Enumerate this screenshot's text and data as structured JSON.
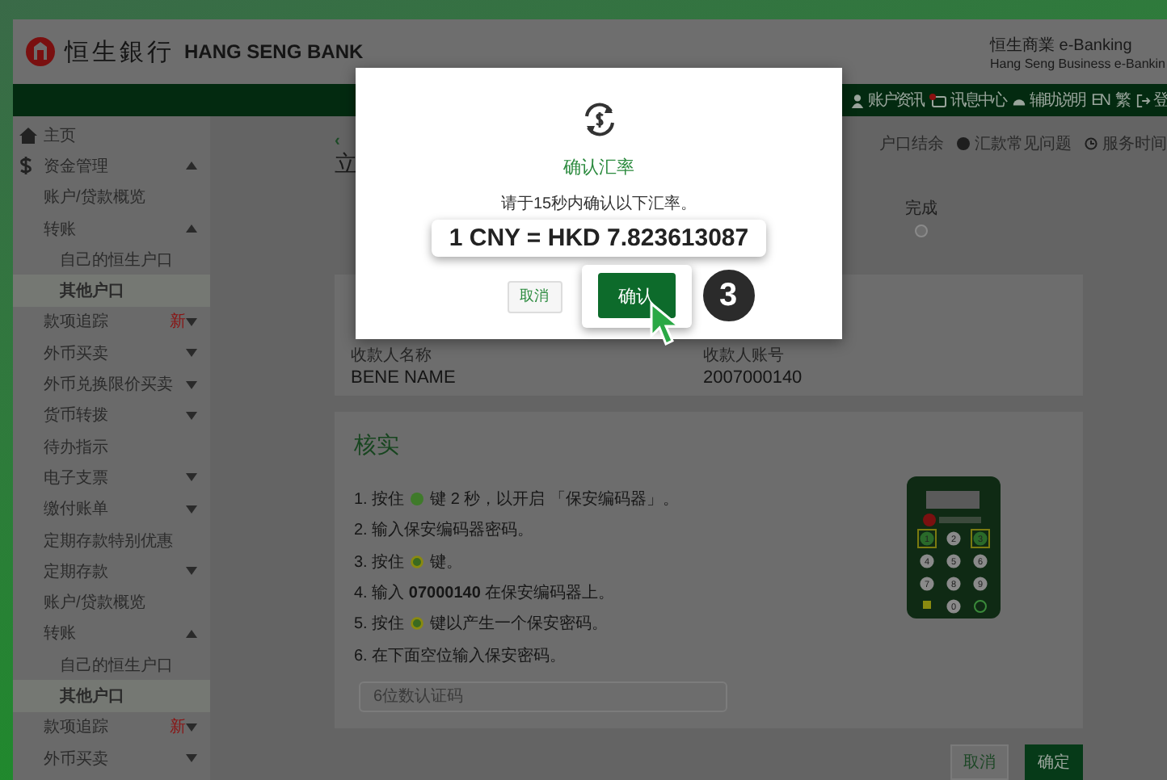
{
  "header": {
    "brand_cn": "恒生銀行",
    "brand_en": "HANG SENG BANK",
    "product_cn": "恒生商業 e-Banking",
    "product_en": "Hang Seng Business e-Bankin"
  },
  "nav": [
    {
      "label": "账户资讯"
    },
    {
      "label": "讯息中心",
      "alert": true
    },
    {
      "label": "辅助说明"
    },
    {
      "label": "EN"
    },
    {
      "label": "繁"
    },
    {
      "label": "登"
    }
  ],
  "sidebar": [
    {
      "label": "主页",
      "selected": false
    },
    {
      "label": "资金管理",
      "expanded": true,
      "selected": false
    },
    {
      "label": "账户/贷款概览",
      "selected": false
    },
    {
      "label": "转账",
      "expanded": true,
      "selected": false,
      "children": [
        {
          "label": "自己的恒生户口",
          "selected": false
        },
        {
          "label": "其他户口",
          "selected": true
        }
      ]
    },
    {
      "label": "款项追踪",
      "badge": "新",
      "expanded": false,
      "selected": false
    },
    {
      "label": "外币买卖",
      "expanded": false,
      "selected": false
    },
    {
      "label": "外币兑换限价买卖",
      "expanded": false,
      "selected": false
    },
    {
      "label": "货币转拨",
      "expanded": false,
      "selected": false
    },
    {
      "label": "待办指示",
      "selected": false
    },
    {
      "label": "电子支票",
      "expanded": false,
      "selected": false
    },
    {
      "label": "缴付账单",
      "expanded": false,
      "selected": false
    },
    {
      "label": "定期存款特别优惠",
      "selected": false
    },
    {
      "label": "定期存款",
      "expanded": false,
      "selected": false
    },
    {
      "label": "账户/贷款概览",
      "selected": false
    },
    {
      "label": "转账",
      "expanded": true,
      "selected": false,
      "children": [
        {
          "label": "自己的恒生户口",
          "selected": false
        },
        {
          "label": "其他户口",
          "selected": true
        }
      ]
    },
    {
      "label": "款项追踪",
      "badge": "新",
      "expanded": false,
      "selected": false
    },
    {
      "label": "外币买卖",
      "expanded": false,
      "selected": false
    }
  ],
  "page": {
    "back": "‹",
    "title": "立",
    "links": [
      {
        "label": "户口结余"
      },
      {
        "label": "汇款常见问题"
      },
      {
        "label": "服务时间"
      }
    ],
    "stepper": {
      "label": "完成",
      "done": false
    },
    "payee": [
      {
        "label": "收款人名称",
        "value": "BENE NAME"
      },
      {
        "label": "收款人账号",
        "value": "2007000140"
      }
    ],
    "verify": {
      "title": "核实",
      "steps": [
        {
          "parts": [
            {
              "kind": "text",
              "text": "1. 按住"
            },
            {
              "kind": "key"
            },
            {
              "kind": "text",
              "text": "键 2 秒，以开启 「保安编码器」。"
            }
          ]
        },
        {
          "parts": [
            {
              "kind": "text",
              "text": "2. 输入保安编码器密码。"
            }
          ]
        },
        {
          "parts": [
            {
              "kind": "text",
              "text": "3. 按住"
            },
            {
              "kind": "ringkey"
            },
            {
              "kind": "text",
              "text": "键。"
            }
          ]
        },
        {
          "parts": [
            {
              "kind": "text",
              "text": "4. 输入 **07000140** 在保安编码器上。"
            }
          ]
        },
        {
          "parts": [
            {
              "kind": "text",
              "text": "5. 按住"
            },
            {
              "kind": "ringkey"
            },
            {
              "kind": "text",
              "text": "键以产生一个保安密码。"
            }
          ]
        },
        {
          "parts": [
            {
              "kind": "text",
              "text": "6. 在下面空位输入保安密码。"
            }
          ]
        }
      ],
      "placeholder": "6位数认证码",
      "keypad": [
        "1",
        "2",
        "3",
        "4",
        "5",
        "6",
        "7",
        "8",
        "9",
        "0"
      ]
    },
    "buttons": [
      {
        "label": "取消",
        "kind": "secondary"
      },
      {
        "label": "确定",
        "kind": "primary"
      }
    ]
  },
  "modal": {
    "title": "确认汇率",
    "message": "请于15秒内确认以下汇率。",
    "rate": "1 CNY = HKD 7.823613087",
    "buttons": [
      {
        "label": "取消",
        "kind": "secondary"
      },
      {
        "label": "确认",
        "kind": "primary",
        "highlighted": true
      }
    ],
    "step_badge": "3"
  }
}
